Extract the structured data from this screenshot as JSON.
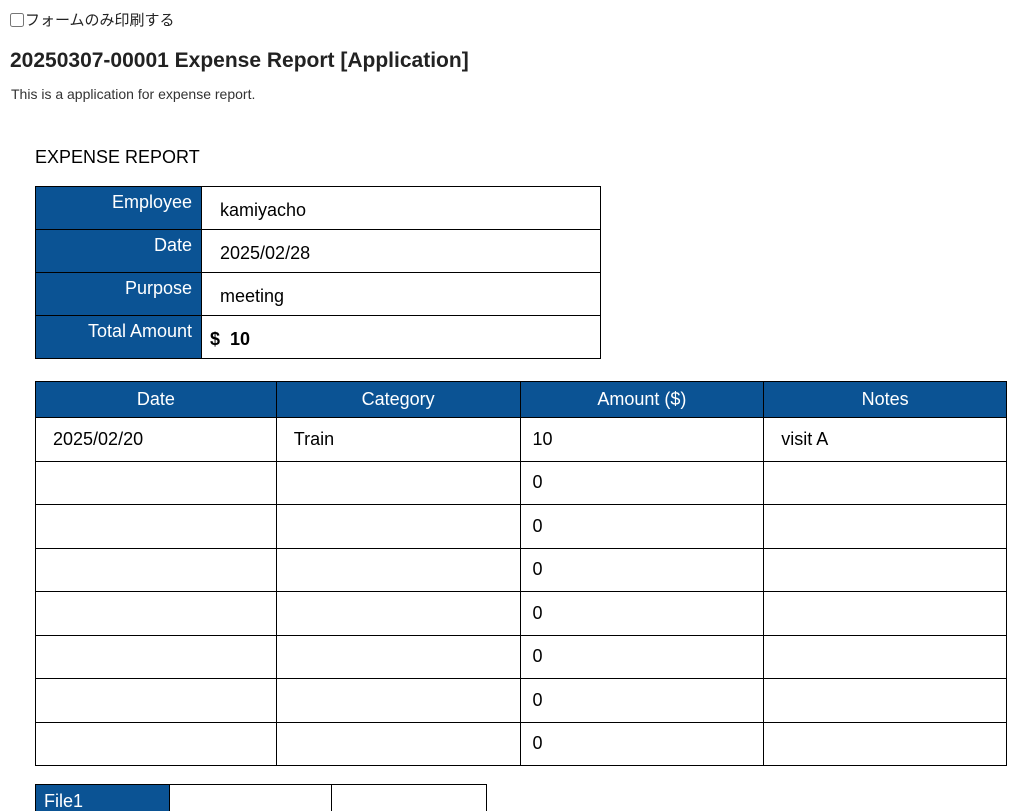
{
  "print_option": {
    "label": "フォームのみ印刷する",
    "checked": false
  },
  "page": {
    "title": "20250307-00001 Expense Report [Application]",
    "description": "This is a application for expense report."
  },
  "form": {
    "heading": "EXPENSE REPORT",
    "summary": {
      "employee_label": "Employee",
      "employee_value": "kamiyacho",
      "date_label": "Date",
      "date_value": "2025/02/28",
      "purpose_label": "Purpose",
      "purpose_value": "meeting",
      "total_label": "Total Amount",
      "total_currency": "$",
      "total_value": "10"
    },
    "items": {
      "headers": [
        "Date",
        "Category",
        "Amount ($)",
        "Notes"
      ],
      "rows": [
        [
          "2025/02/20",
          "Train",
          "10",
          "visit A"
        ],
        [
          "",
          "",
          "0",
          ""
        ],
        [
          "",
          "",
          "0",
          ""
        ],
        [
          "",
          "",
          "0",
          ""
        ],
        [
          "",
          "",
          "0",
          ""
        ],
        [
          "",
          "",
          "0",
          ""
        ],
        [
          "",
          "",
          "0",
          ""
        ],
        [
          "",
          "",
          "0",
          ""
        ]
      ]
    },
    "files": {
      "label": "File1"
    }
  }
}
